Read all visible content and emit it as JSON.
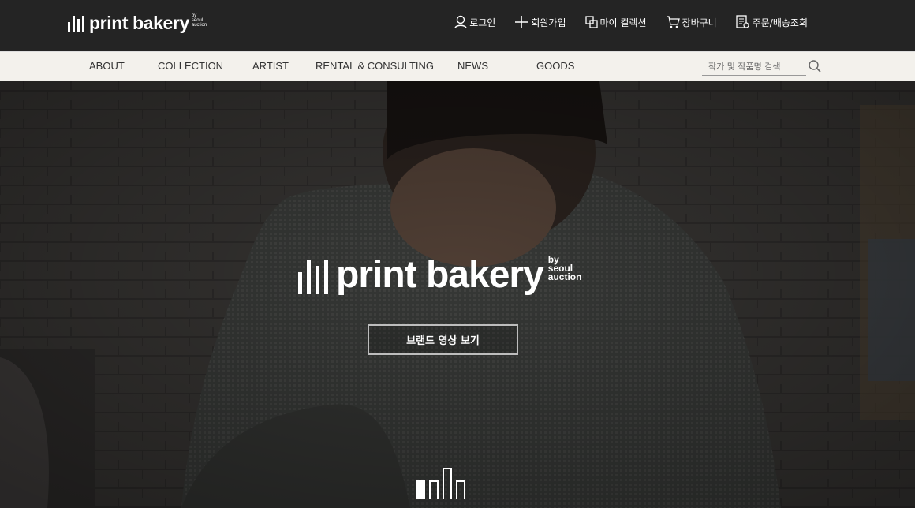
{
  "brand": {
    "name": "print bakery",
    "by": "by\nseoul\nauction"
  },
  "util_menu": [
    {
      "label": "로그인",
      "icon": "person-icon"
    },
    {
      "label": "회원가입",
      "icon": "plus-icon"
    },
    {
      "label": "마이 컬렉션",
      "icon": "collection-icon"
    },
    {
      "label": "장바구니",
      "icon": "cart-icon"
    },
    {
      "label": "주문/배송조회",
      "icon": "order-icon"
    }
  ],
  "nav": [
    {
      "label": "ABOUT"
    },
    {
      "label": "COLLECTION"
    },
    {
      "label": "ARTIST"
    },
    {
      "label": "RENTAL & CONSULTING"
    },
    {
      "label": "NEWS"
    },
    {
      "label": "GOODS"
    }
  ],
  "search": {
    "placeholder": "작가 및 작품명 검색",
    "icon": "search-icon"
  },
  "hero": {
    "logo_text": "print bakery",
    "logo_by": "by\nseoul\nauction",
    "button_label": "브랜드 영상 보기",
    "active_slide": 1,
    "slide_count": 4
  },
  "colors": {
    "topbar": "#242424",
    "navbar": "#f3f1ec",
    "hero_overlay": "#3a3836"
  }
}
